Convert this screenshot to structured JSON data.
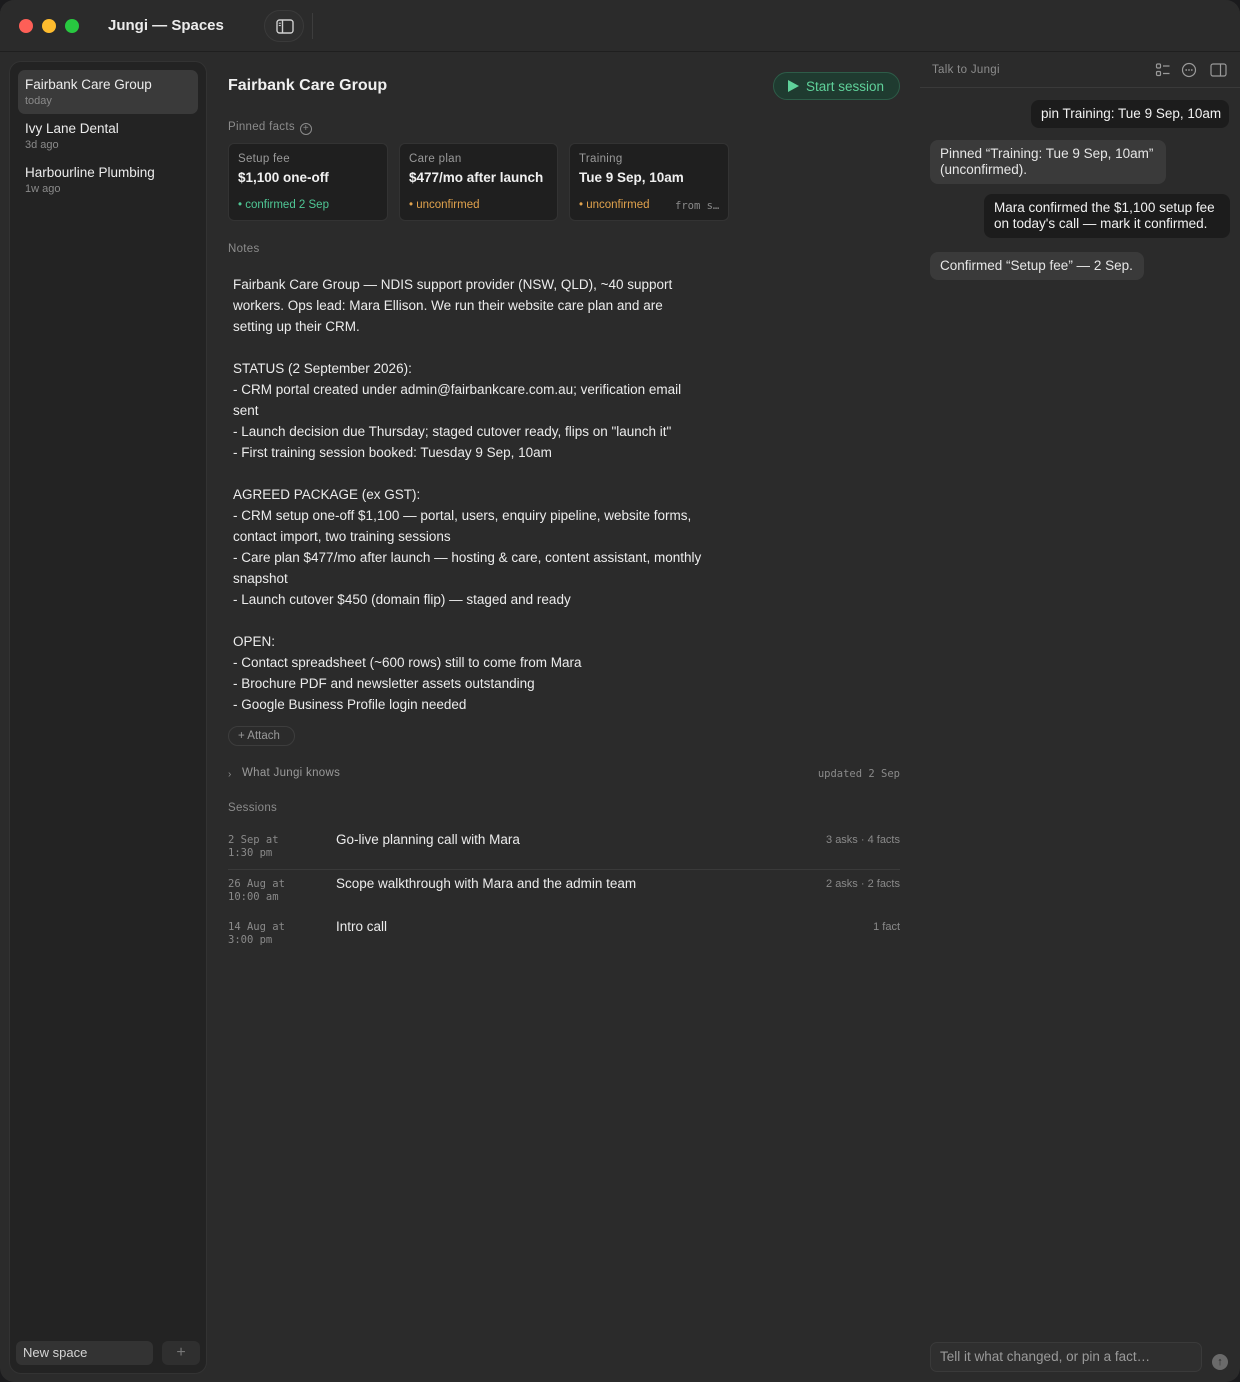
{
  "window": {
    "title": "Jungi — Spaces"
  },
  "sidebar": {
    "items": [
      {
        "name": "Fairbank Care Group",
        "time": "today",
        "active": true
      },
      {
        "name": "Ivy Lane Dental",
        "time": "3d ago",
        "active": false
      },
      {
        "name": "Harbourline Plumbing",
        "time": "1w ago",
        "active": false
      }
    ],
    "new_space_label": "New space",
    "add_symbol": "+"
  },
  "main": {
    "title": "Fairbank Care Group",
    "start_session_label": "Start session",
    "pinned_label": "Pinned facts",
    "pinned_add_symbol": "+",
    "facts": [
      {
        "label": "Setup fee",
        "value": "$1,100 one-off",
        "status": "• confirmed 2 Sep",
        "status_kind": "confirmed",
        "from": ""
      },
      {
        "label": "Care plan",
        "value": "$477/mo after launch",
        "status": "• unconfirmed",
        "status_kind": "unconfirmed",
        "from": ""
      },
      {
        "label": "Training",
        "value": "Tue 9 Sep, 10am",
        "status": "• unconfirmed",
        "status_kind": "unconfirmed",
        "from": "from s…"
      }
    ],
    "notes_label": "Notes",
    "notes_text": "Fairbank Care Group — NDIS support provider (NSW, QLD), ~40 support workers. Ops lead: Mara Ellison. We run their website care plan and are setting up their CRM.\n\nSTATUS (2 September 2026):\n- CRM portal created under admin@fairbankcare.com.au; verification email sent\n- Launch decision due Thursday; staged cutover ready, flips on \"launch it\"\n- First training session booked: Tuesday 9 Sep, 10am\n\nAGREED PACKAGE (ex GST):\n- CRM setup one-off $1,100 — portal, users, enquiry pipeline, website forms, contact import, two training sessions\n- Care plan $477/mo after launch — hosting & care, content assistant, monthly snapshot\n- Launch cutover $450 (domain flip) — staged and ready\n\nOPEN:\n- Contact spreadsheet (~600 rows) still to come from Mara\n- Brochure PDF and newsletter assets outstanding\n- Google Business Profile login needed",
    "attach_label": "+ Attach",
    "knows_label": "What Jungi knows",
    "knows_chevron": "›",
    "knows_updated": "updated 2 Sep",
    "sessions_label": "Sessions",
    "sessions": [
      {
        "date": "2 Sep at\n1:30 pm",
        "title": "Go-live planning call with Mara",
        "meta": "3 asks · 4 facts"
      },
      {
        "date": "26 Aug at\n10:00 am",
        "title": "Scope walkthrough with Mara and the admin team",
        "meta": "2 asks · 2 facts"
      },
      {
        "date": "14 Aug at\n3:00 pm",
        "title": "Intro call",
        "meta": "1 fact"
      }
    ]
  },
  "chat": {
    "title": "Talk to Jungi",
    "messages": [
      {
        "role": "user",
        "text": "pin Training: Tue 9 Sep, 10am"
      },
      {
        "role": "bot",
        "text": "Pinned “Training: Tue 9 Sep, 10am” (unconfirmed)."
      },
      {
        "role": "user",
        "text": "Mara confirmed the $1,100 setup fee on today's call — mark it confirmed."
      },
      {
        "role": "bot",
        "text": "Confirmed “Setup fee” — 2 Sep."
      }
    ],
    "input_placeholder": "Tell it what changed, or pin a fact…",
    "send_symbol": "↑"
  },
  "colors": {
    "accent_green": "#5fd19a",
    "confirmed": "#4fc795",
    "unconfirmed": "#e0a24d"
  }
}
